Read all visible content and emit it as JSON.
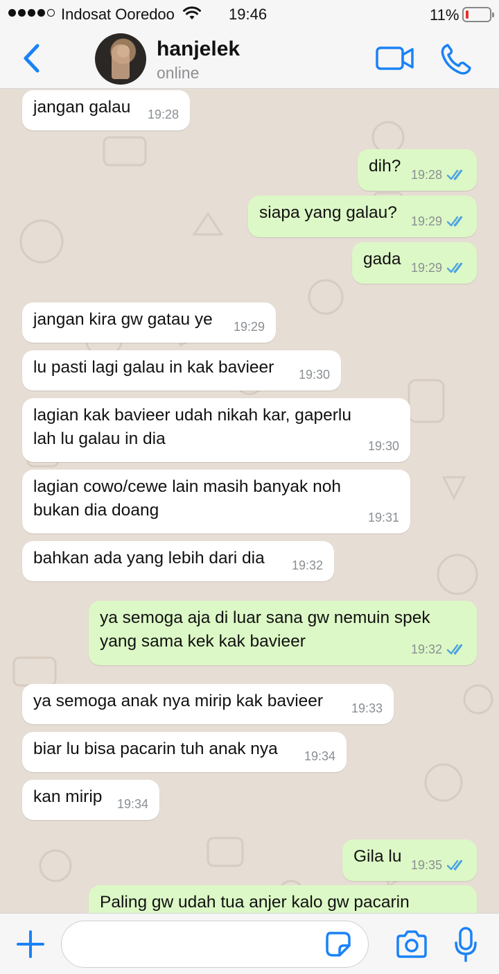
{
  "status_bar": {
    "carrier": "Indosat Ooredoo",
    "time": "19:46",
    "battery": "11%",
    "battery_level": 0.11
  },
  "header": {
    "name": "hanjelek",
    "status": "online"
  },
  "colors": {
    "accent": "#1a82f7",
    "outgoing_bubble": "#dcf8c6",
    "incoming_bubble": "#ffffff",
    "read_ticks": "#4fa3e0",
    "battery_low": "#e8322b"
  },
  "messages": [
    {
      "dir": "in",
      "lines": [
        "jangan galau"
      ],
      "time": "19:28"
    },
    {
      "dir": "out",
      "lines": [
        "dih?"
      ],
      "time": "19:28",
      "read": true
    },
    {
      "dir": "out",
      "lines": [
        "siapa yang galau?"
      ],
      "time": "19:29",
      "read": true
    },
    {
      "dir": "out",
      "lines": [
        "gada"
      ],
      "time": "19:29",
      "read": true
    },
    {
      "dir": "in",
      "lines": [
        "jangan kira gw gatau ye"
      ],
      "time": "19:29"
    },
    {
      "dir": "in",
      "lines": [
        "lu pasti lagi galau in kak bavieer"
      ],
      "time": "19:30"
    },
    {
      "dir": "in",
      "lines": [
        "lagian kak bavieer udah nikah kar, gaperlu",
        "lah lu galau in dia"
      ],
      "time": "19:30"
    },
    {
      "dir": "in",
      "lines": [
        "lagian cowo/cewe lain masih banyak noh",
        "bukan dia doang"
      ],
      "time": "19:31"
    },
    {
      "dir": "in",
      "lines": [
        "bahkan ada yang lebih dari dia"
      ],
      "time": "19:32"
    },
    {
      "dir": "out",
      "lines": [
        "ya semoga aja di luar sana gw nemuin spek",
        "yang sama kek kak bavieer"
      ],
      "time": "19:32",
      "read": true
    },
    {
      "dir": "in",
      "lines": [
        "ya semoga anak nya mirip kak bavieer"
      ],
      "time": "19:33"
    },
    {
      "dir": "in",
      "lines": [
        "biar lu bisa pacarin tuh anak nya"
      ],
      "time": "19:34"
    },
    {
      "dir": "in",
      "lines": [
        "kan mirip"
      ],
      "time": "19:34"
    },
    {
      "dir": "out",
      "lines": [
        "Gila lu"
      ],
      "time": "19:35",
      "read": true
    },
    {
      "dir": "out",
      "lines": [
        "Paling gw udah tua anjer kalo gw pacarin"
      ],
      "time": "",
      "read": false
    }
  ],
  "input": {
    "placeholder": "",
    "value": ""
  }
}
